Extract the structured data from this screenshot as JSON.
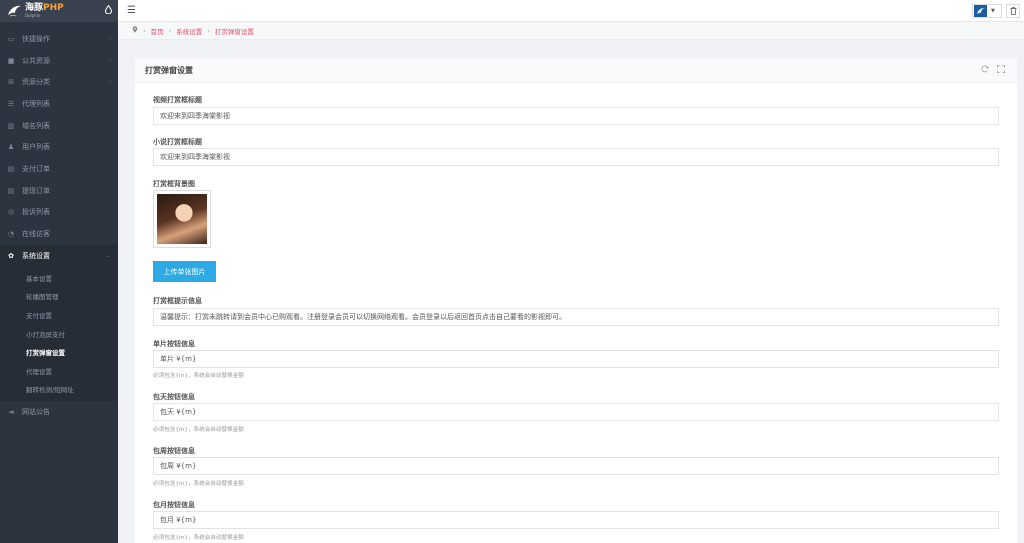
{
  "brand": {
    "name_main": "海豚",
    "name_accent": "PHP",
    "name_sub": "Dolphin"
  },
  "sidebar": {
    "items": [
      {
        "icon": "folder-open-icon",
        "glyph": "▭",
        "label": "快捷操作",
        "chevron": true
      },
      {
        "icon": "video-icon",
        "glyph": "■",
        "label": "公共资源",
        "chevron": true
      },
      {
        "icon": "grid-icon",
        "glyph": "⊞",
        "label": "资源分类",
        "chevron": true
      },
      {
        "icon": "list-icon",
        "glyph": "☰",
        "label": "代理列表",
        "chevron": false
      },
      {
        "icon": "bar-chart-icon",
        "glyph": "▥",
        "label": "域名列表",
        "chevron": false
      },
      {
        "icon": "user-icon",
        "glyph": "♟",
        "label": "用户列表",
        "chevron": false
      },
      {
        "icon": "document-icon",
        "glyph": "▤",
        "label": "支付订单",
        "chevron": false
      },
      {
        "icon": "document-icon",
        "glyph": "▤",
        "label": "提现订单",
        "chevron": false
      },
      {
        "icon": "complaint-icon",
        "glyph": "◎",
        "label": "投诉列表",
        "chevron": false
      },
      {
        "icon": "visitor-icon",
        "glyph": "◔",
        "label": "在线访客",
        "chevron": false
      }
    ],
    "active_group": {
      "icon": "gear-icon",
      "glyph": "✿",
      "label": "系统设置"
    },
    "sub_items": [
      "基本设置",
      "轮播图管理",
      "支付设置",
      "小灯泡屏支付",
      "打赏弹窗设置",
      "代理设置",
      "翻转检测/短网址"
    ],
    "current_sub": 4,
    "after_items": [
      {
        "icon": "megaphone-icon",
        "glyph": "◄",
        "label": "网站公告"
      }
    ]
  },
  "breadcrumb": {
    "home_icon": "location-icon",
    "items": [
      "首页",
      "系统设置",
      "打赏弹窗设置"
    ]
  },
  "card": {
    "title": "打赏弹窗设置"
  },
  "form": {
    "video_title_label": "视频打赏框标题",
    "video_title_value": "欢迎来到四季海棠影视",
    "novel_title_label": "小说打赏框标题",
    "novel_title_value": "欢迎来到四季海棠影视",
    "bg_label": "打赏框背景图",
    "upload_label": "上传单张图片",
    "tip_label": "打赏框提示信息",
    "tip_value": "温馨提示：打赏未跳转请到会员中心已购观看。注册登录会员可以切换网络观看。会员登录以后返回首页点击自己要看的影视即可。",
    "single_label": "单片按钮信息",
    "single_value": "单片   ¥{m}",
    "day_label": "包天按钮信息",
    "day_value": "包天   ¥{m}",
    "week_label": "包周按钮信息",
    "week_value": "包周   ¥{m}",
    "month_label": "包月按钮信息",
    "month_value": "包月   ¥{m}",
    "help_text": "必须包含{m}，系统会自动替换金额"
  }
}
